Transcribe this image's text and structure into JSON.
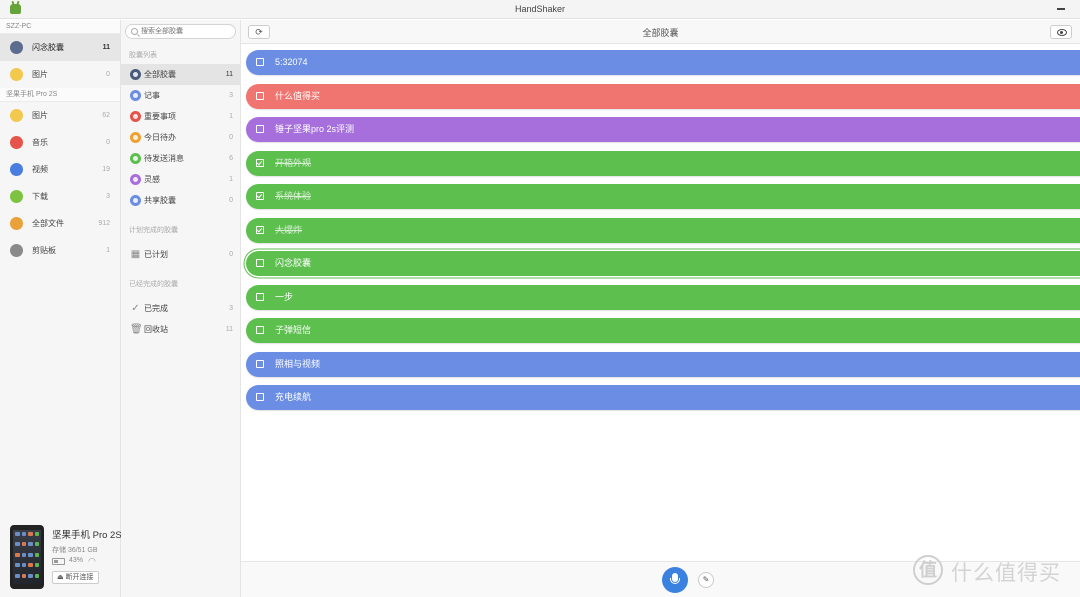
{
  "window": {
    "title": "HandShaker"
  },
  "pc_section": {
    "header": "SZZ-PC",
    "items": [
      {
        "label": "闪念胶囊",
        "count": "11",
        "icon": "capsule-icon",
        "color": "#5b6c8f",
        "active": true
      },
      {
        "label": "图片",
        "count": "0",
        "icon": "image-icon",
        "color": "#f2c94c",
        "active": false
      }
    ]
  },
  "phone_section": {
    "header": "坚果手机 Pro 2S",
    "items": [
      {
        "label": "图片",
        "count": "62",
        "icon": "image-icon",
        "color": "#f2c94c"
      },
      {
        "label": "音乐",
        "count": "0",
        "icon": "music-icon",
        "color": "#e5534b"
      },
      {
        "label": "视频",
        "count": "19",
        "icon": "video-icon",
        "color": "#4a7de0"
      },
      {
        "label": "下载",
        "count": "3",
        "icon": "download-icon",
        "color": "#7ec242"
      },
      {
        "label": "全部文件",
        "count": "912",
        "icon": "all-files-icon",
        "color": "#e9a23b"
      },
      {
        "label": "剪贴板",
        "count": "1",
        "icon": "clipboard-icon",
        "color": "#8a8a8a"
      }
    ]
  },
  "device": {
    "name": "坚果手机 Pro 2S",
    "storage": "存储 36/51 GB",
    "battery": "43%",
    "disconnect": "⏏ 断开连接"
  },
  "search": {
    "placeholder": "搜索全部胶囊"
  },
  "capsule_nav": {
    "group1_label": "胶囊列表",
    "group1": [
      {
        "label": "全部胶囊",
        "count": "11",
        "icon": "all-capsules-icon",
        "color": "#4a5a7a",
        "active": true
      },
      {
        "label": "记事",
        "count": "3",
        "icon": "note-icon",
        "color": "#6b8ee4",
        "active": false
      },
      {
        "label": "重要事项",
        "count": "1",
        "icon": "important-icon",
        "color": "#e5534b",
        "active": false
      },
      {
        "label": "今日待办",
        "count": "0",
        "icon": "today-todo-icon",
        "color": "#f0a030",
        "active": false
      },
      {
        "label": "待发送消息",
        "count": "6",
        "icon": "pending-message-icon",
        "color": "#5cbf4e",
        "active": false
      },
      {
        "label": "灵感",
        "count": "1",
        "icon": "inspiration-icon",
        "color": "#a66fdb",
        "active": false
      },
      {
        "label": "共享胶囊",
        "count": "0",
        "icon": "shared-capsule-icon",
        "color": "#6b8ee4",
        "active": false
      }
    ],
    "group2_label": "计划完成的胶囊",
    "group2": [
      {
        "label": "已计划",
        "count": "0",
        "icon": "calendar-icon",
        "glyph": "▦"
      }
    ],
    "group3_label": "已经完成的胶囊",
    "group3": [
      {
        "label": "已完成",
        "count": "3",
        "icon": "check-icon",
        "glyph": "✓"
      },
      {
        "label": "回收站",
        "count": "11",
        "icon": "trash-icon",
        "glyph": "🗑"
      }
    ]
  },
  "main": {
    "title": "全部胶囊",
    "refresh_glyph": "⟳",
    "edit_glyph": "✎",
    "capsules": [
      {
        "text": "5:32074",
        "color": "blue",
        "done": false,
        "selected": false
      },
      {
        "text": "什么值得买",
        "color": "red",
        "done": false,
        "selected": false
      },
      {
        "text": "锤子坚果pro 2s评测",
        "color": "purple",
        "done": false,
        "selected": false
      },
      {
        "text": "开箱外观",
        "color": "green",
        "done": true,
        "selected": false
      },
      {
        "text": "系统体验",
        "color": "green",
        "done": true,
        "selected": false
      },
      {
        "text": "大爆炸",
        "color": "green",
        "done": true,
        "selected": false
      },
      {
        "text": "闪念胶囊",
        "color": "green",
        "done": false,
        "selected": true
      },
      {
        "text": "一步",
        "color": "green",
        "done": false,
        "selected": false
      },
      {
        "text": "子弹短信",
        "color": "green",
        "done": false,
        "selected": false
      },
      {
        "text": "照相与视频",
        "color": "blue",
        "done": false,
        "selected": false
      },
      {
        "text": "充电续航",
        "color": "blue",
        "done": false,
        "selected": false
      }
    ]
  },
  "watermark": {
    "logo": "值",
    "text": "什么值得买"
  }
}
